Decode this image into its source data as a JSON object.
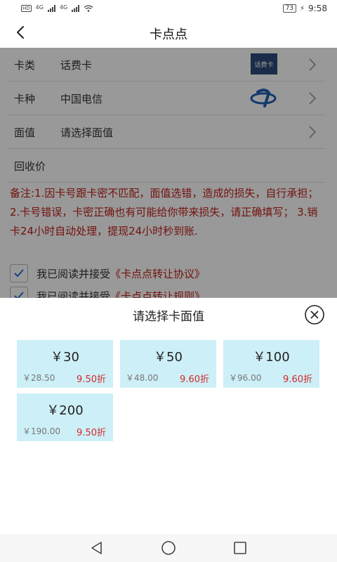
{
  "status_bar": {
    "left_badges": [
      "HD",
      "4G",
      "4G"
    ],
    "battery": "73",
    "time": "9:58"
  },
  "header": {
    "title": "卡点点"
  },
  "form": {
    "rows": [
      {
        "label": "卡类",
        "value": "话费卡",
        "image_text": "话费卡"
      },
      {
        "label": "卡种",
        "value": "中国电信"
      },
      {
        "label": "面值",
        "value": "请选择面值"
      },
      {
        "label": "回收价",
        "value": ""
      }
    ],
    "note": "备注:1.因卡号跟卡密不匹配，面值选错，造成的损失，自行承担； 2.卡号错误，卡密正确也有可能给你带来损失，请正确填写； 3.销卡24小时自动处理，提现24小时秒到账.",
    "agreements": [
      {
        "prefix": "我已阅读并接受",
        "link": "《卡点点转让协议》",
        "checked": true
      },
      {
        "prefix": "我已阅读并接受",
        "link": "《卡点点转让规则》",
        "checked": true
      }
    ]
  },
  "sheet": {
    "title": "请选择卡面值",
    "options": [
      {
        "face": "￥30",
        "price": "￥28.50",
        "discount": "9.50折"
      },
      {
        "face": "￥50",
        "price": "￥48.00",
        "discount": "9.60折"
      },
      {
        "face": "￥100",
        "price": "￥96.00",
        "discount": "9.60折"
      },
      {
        "face": "￥200",
        "price": "￥190.00",
        "discount": "9.50折"
      }
    ]
  },
  "colors": {
    "accent_red": "#c0201a",
    "option_bg": "#cdeff7",
    "check_blue": "#2a6fd6",
    "telecom_blue": "#1f5fb3"
  },
  "icons": {
    "back": "back-arrow-icon",
    "chevron": "chevron-right-icon",
    "close": "close-circle-icon",
    "check": "check-icon",
    "nav_back": "nav-back-icon",
    "nav_home": "nav-home-icon",
    "nav_recent": "nav-recent-icon"
  }
}
